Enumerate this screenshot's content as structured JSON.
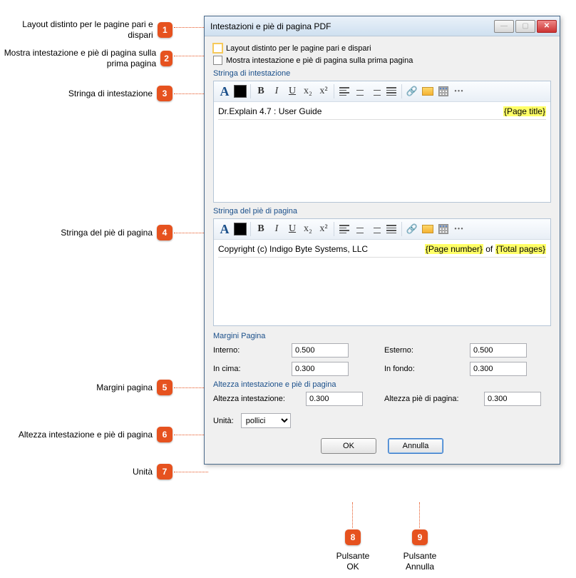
{
  "callouts": {
    "c1": "Layout distinto per le pagine pari e dispari",
    "c2": "Mostra intestazione e piè di pagina sulla prima pagina",
    "c3": "Stringa di intestazione",
    "c4": "Stringa del piè di pagina",
    "c5": "Margini pagina",
    "c6": "Altezza intestazione e piè di pagina",
    "c7": "Unità",
    "c8": "Pulsante OK",
    "c9": "Pulsante Annulla"
  },
  "dialog": {
    "title": "Intestazioni e piè di pagina PDF",
    "chk1": "Layout distinto per le pagine pari e dispari",
    "chk2": "Mostra intestazione e piè di pagina sulla prima pagina",
    "header_group": "Stringa di intestazione",
    "footer_group": "Stringa del piè di pagina",
    "header_left": "Dr.Explain 4.7 : User Guide",
    "header_ph": "{Page title}",
    "footer_left": "Copyright (c) Indigo Byte Systems, LLC",
    "footer_ph1": "{Page number}",
    "footer_of": " of ",
    "footer_ph2": "{Total pages}",
    "margins_title": "Margini Pagina",
    "m_inner_lbl": "Interno:",
    "m_inner": "0.500",
    "m_outer_lbl": "Esterno:",
    "m_outer": "0.500",
    "m_top_lbl": "In cima:",
    "m_top": "0.300",
    "m_bottom_lbl": "In fondo:",
    "m_bottom": "0.300",
    "heights_title": "Altezza intestazione e piè di pagina",
    "h_header_lbl": "Altezza intestazione:",
    "h_header": "0.300",
    "h_footer_lbl": "Altezza piè di pagina:",
    "h_footer": "0.300",
    "units_lbl": "Unità:",
    "units_val": "pollici",
    "ok": "OK",
    "cancel": "Annulla"
  },
  "toolbar_tips": {
    "font": "A",
    "bold": "B",
    "italic": "I",
    "underline": "U",
    "sub": "x₂",
    "sup": "x²"
  }
}
